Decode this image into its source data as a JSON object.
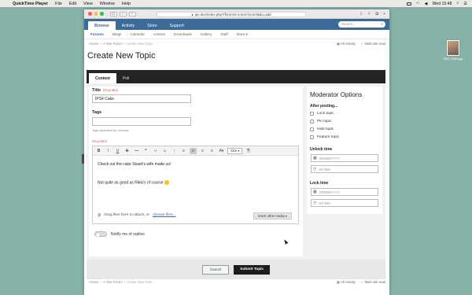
{
  "menubar": {
    "app": "QuickTime Player",
    "items": [
      "File",
      "Edit",
      "View",
      "Window",
      "Help"
    ],
    "clock": "Wed 15:48"
  },
  "desktop": {
    "file_name": "IMG_3364.jpg"
  },
  "browser": {
    "url": "ips.dev/index.php?/forum/2-a-test-forum/&do=add"
  },
  "site": {
    "tabs": [
      "Browse",
      "Activity",
      "Store",
      "Support"
    ],
    "search_placeholder": "Search...",
    "subnav": [
      "Forums",
      "Blogs",
      "Calendar",
      "Articles",
      "Downloads",
      "Gallery",
      "Staff",
      "More ▾"
    ]
  },
  "breadcrumb": {
    "items": [
      "Home",
      "A Test Forum",
      "Create New Topic"
    ],
    "all_activity": "All Activity",
    "mark_read": "Mark site read"
  },
  "page_title": "Create New Topic",
  "composer": {
    "tabs": [
      "Content",
      "Poll"
    ],
    "title_label": "Title",
    "required": "REQUIRED",
    "title_value": "IPS4 Cake",
    "tags_label": "Tags",
    "tags_hint": "Tags separated by commas.",
    "editor_size": "Size",
    "body_lines": [
      "Check out the cake Stuart's wife made us!",
      "Not quite as good as Rikki's of course"
    ],
    "attach_text": "Drag files here to attach, or",
    "attach_link": "choose files...",
    "insert_media": "Insert other media ▾",
    "notify_label": "Notify me of replies"
  },
  "moderator": {
    "title": "Moderator Options",
    "after_posting": "After posting...",
    "options": [
      "Lock topic",
      "Pin topic",
      "Hide topic",
      "Feature topic"
    ],
    "unlock_label": "Unlock time",
    "lock_label": "Lock time",
    "date_placeholder": "DD/MM/YYYY",
    "time_placeholder": "HH:MM"
  },
  "buttons": {
    "cancel": "Cancel",
    "submit": "Submit Topic"
  }
}
